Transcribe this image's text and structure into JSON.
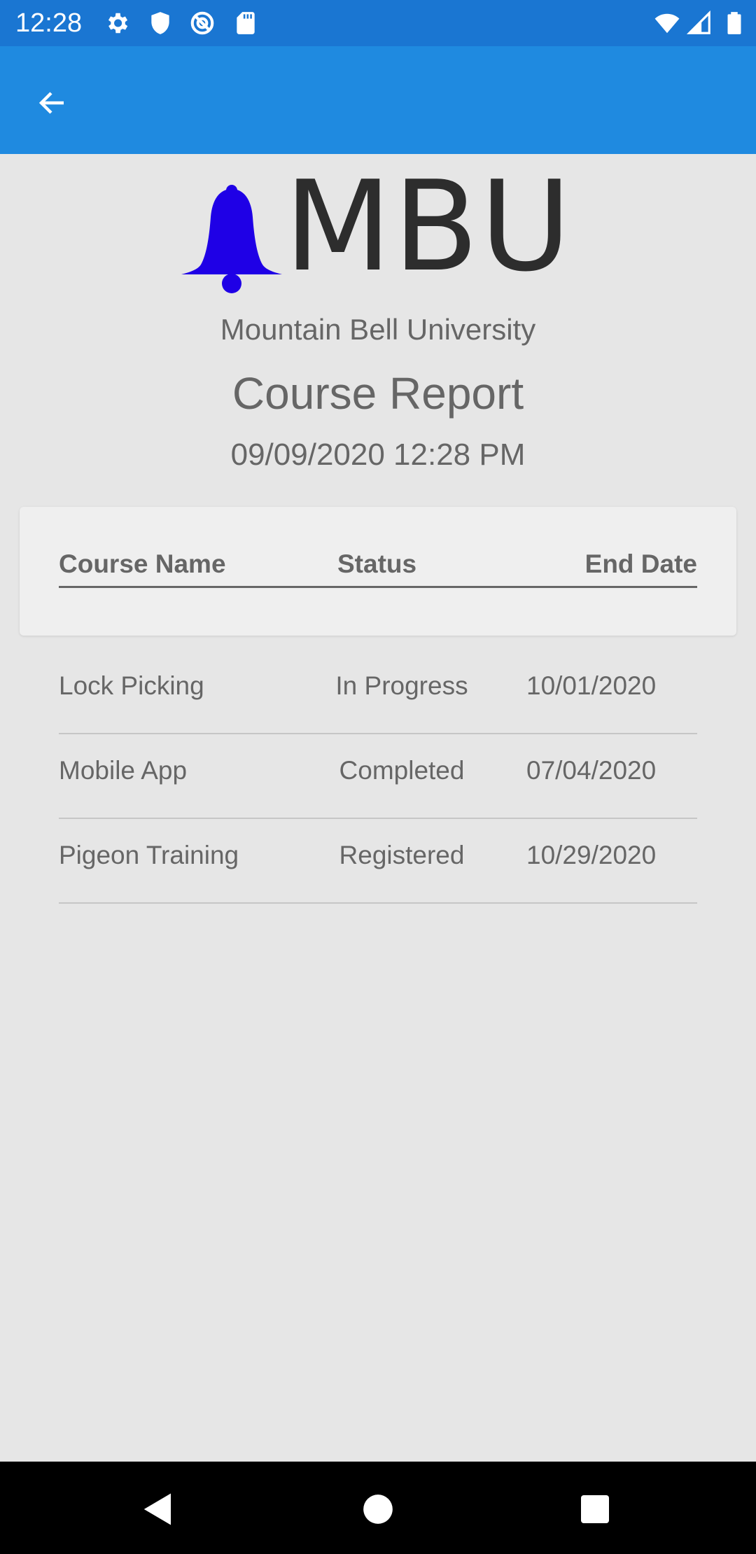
{
  "status_bar": {
    "time": "12:28",
    "icons": [
      "gear-icon",
      "shield-icon",
      "no-data-icon",
      "sd-card-icon",
      "wifi-icon",
      "signal-icon",
      "battery-icon"
    ]
  },
  "app_bar": {
    "back_icon": "arrow-left-icon",
    "color": "#1f8ae0"
  },
  "logo": {
    "text": "MBU",
    "bell_color": "#1f00e6"
  },
  "header": {
    "university": "Mountain Bell University",
    "title": "Course Report",
    "date": "09/09/2020 12:28 PM"
  },
  "table": {
    "columns": [
      "Course Name",
      "Status",
      "End Date"
    ],
    "rows": [
      {
        "course": "Lock Picking",
        "status": "In Progress",
        "end_date": "10/01/2020"
      },
      {
        "course": "Mobile App",
        "status": "Completed",
        "end_date": "07/04/2020"
      },
      {
        "course": "Pigeon Training",
        "status": "Registered",
        "end_date": "10/29/2020"
      }
    ]
  },
  "nav_bar": {
    "buttons": [
      "back-triangle-icon",
      "home-circle-icon",
      "recents-square-icon"
    ]
  }
}
